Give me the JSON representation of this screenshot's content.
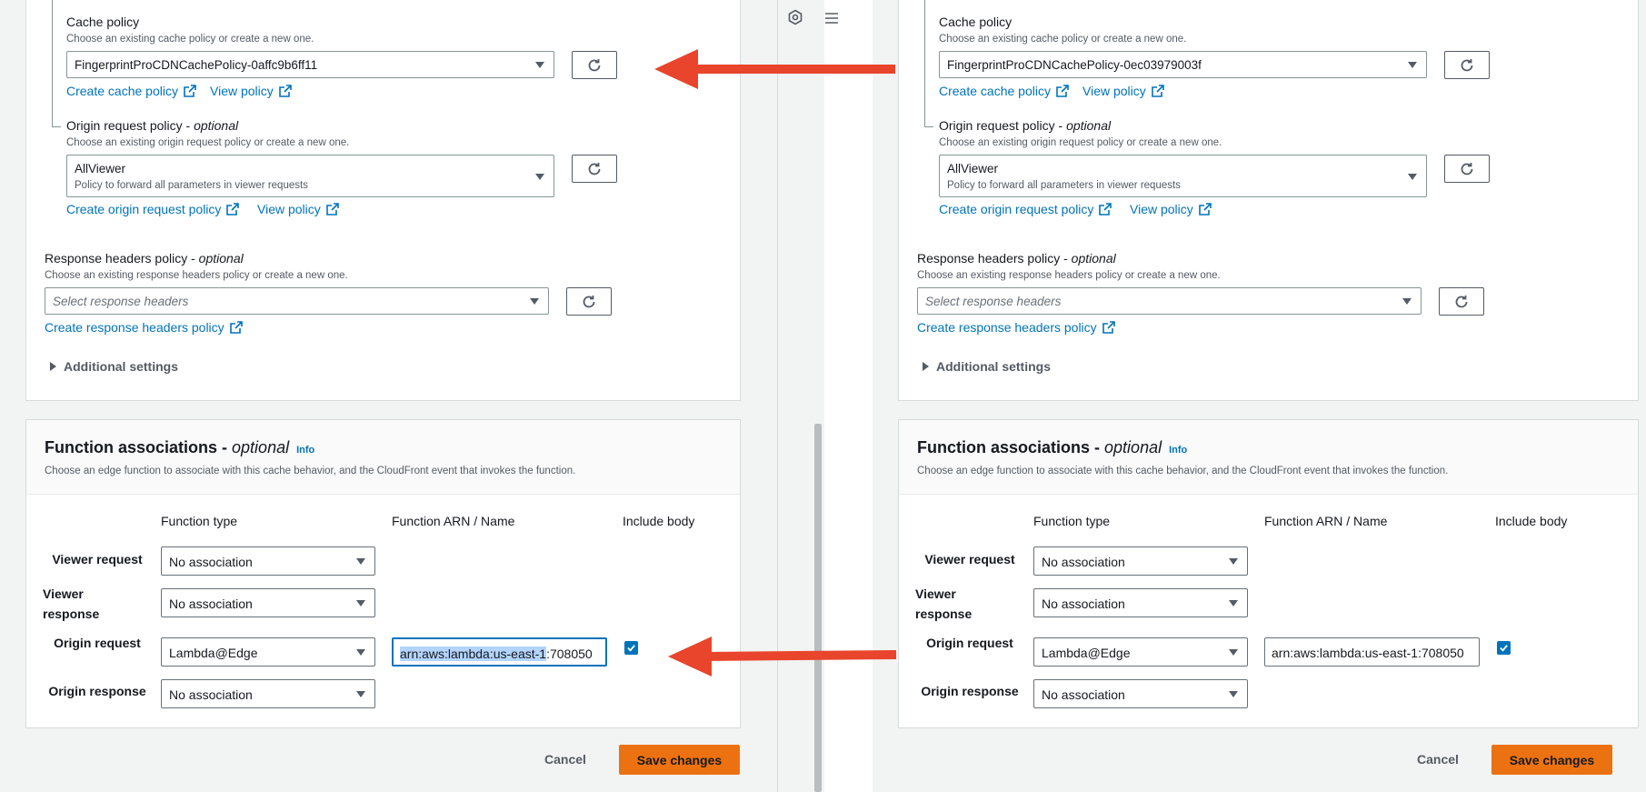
{
  "panes": [
    {
      "id": "left",
      "cache_policy": {
        "label": "Cache policy",
        "hint": "Choose an existing cache policy or create a new one.",
        "selected": "FingerprintProCDNCachePolicy-0affc9b6ff11",
        "create_link": "Create cache policy",
        "view_link": "View policy"
      },
      "origin_request_policy": {
        "label": "Origin request policy",
        "label_optional": "optional",
        "hint": "Choose an existing origin request policy or create a new one.",
        "selected": "AllViewer",
        "selected_desc": "Policy to forward all parameters in viewer requests",
        "create_link": "Create origin request policy",
        "view_link": "View policy"
      },
      "response_headers_policy": {
        "label": "Response headers policy",
        "label_optional": "optional",
        "hint": "Choose an existing response headers policy or create a new one.",
        "placeholder": "Select response headers",
        "create_link": "Create response headers policy"
      },
      "additional_settings": "Additional settings",
      "function_associations": {
        "title": "Function associations",
        "title_optional": "optional",
        "info": "Info",
        "description": "Choose an edge function to associate with this cache behavior, and the CloudFront event that invokes the function.",
        "columns": [
          "Function type",
          "Function ARN / Name",
          "Include body"
        ],
        "rows": [
          {
            "label_line1": "Viewer request",
            "label_line2": "",
            "type": "No association"
          },
          {
            "label_line1": "Viewer",
            "label_line2": "response",
            "type": "No association"
          },
          {
            "label_line1": "Origin request",
            "label_line2": "",
            "type": "Lambda@Edge",
            "arn_selected": "arn:aws:lambda:us-east-1",
            "arn_rest": ":708050",
            "include_body": true
          },
          {
            "label_line1": "Origin response",
            "label_line2": "",
            "type": "No association"
          }
        ]
      },
      "footer": {
        "cancel": "Cancel",
        "save": "Save changes"
      }
    },
    {
      "id": "right",
      "cache_policy": {
        "label": "Cache policy",
        "hint": "Choose an existing cache policy or create a new one.",
        "selected": "FingerprintProCDNCachePolicy-0ec03979003f",
        "create_link": "Create cache policy",
        "view_link": "View policy"
      },
      "origin_request_policy": {
        "label": "Origin request policy",
        "label_optional": "optional",
        "hint": "Choose an existing origin request policy or create a new one.",
        "selected": "AllViewer",
        "selected_desc": "Policy to forward all parameters in viewer requests",
        "create_link": "Create origin request policy",
        "view_link": "View policy"
      },
      "response_headers_policy": {
        "label": "Response headers policy",
        "label_optional": "optional",
        "hint": "Choose an existing response headers policy or create a new one.",
        "placeholder": "Select response headers",
        "create_link": "Create response headers policy"
      },
      "additional_settings": "Additional settings",
      "function_associations": {
        "title": "Function associations",
        "title_optional": "optional",
        "info": "Info",
        "description": "Choose an edge function to associate with this cache behavior, and the CloudFront event that invokes the function.",
        "columns": [
          "Function type",
          "Function ARN / Name",
          "Include body"
        ],
        "rows": [
          {
            "label_line1": "Viewer request",
            "label_line2": "",
            "type": "No association"
          },
          {
            "label_line1": "Viewer",
            "label_line2": "response",
            "type": "No association"
          },
          {
            "label_line1": "Origin request",
            "label_line2": "",
            "type": "Lambda@Edge",
            "arn_selected": "",
            "arn_rest": "arn:aws:lambda:us-east-1:708050",
            "include_body": true
          },
          {
            "label_line1": "Origin response",
            "label_line2": "",
            "type": "No association"
          }
        ]
      },
      "footer": {
        "cancel": "Cancel",
        "save": "Save changes"
      }
    }
  ],
  "colors": {
    "link": "#0073bb",
    "primary_button": "#ec7211",
    "annotation_arrow": "#e8452c",
    "checkbox": "#0073bb",
    "selection_highlight": "#b3d4fc"
  },
  "icons": [
    "refresh-icon",
    "external-link-icon",
    "caret-down-icon",
    "caret-right-icon",
    "checkmark-icon",
    "settings-icon",
    "menu-icon"
  ]
}
